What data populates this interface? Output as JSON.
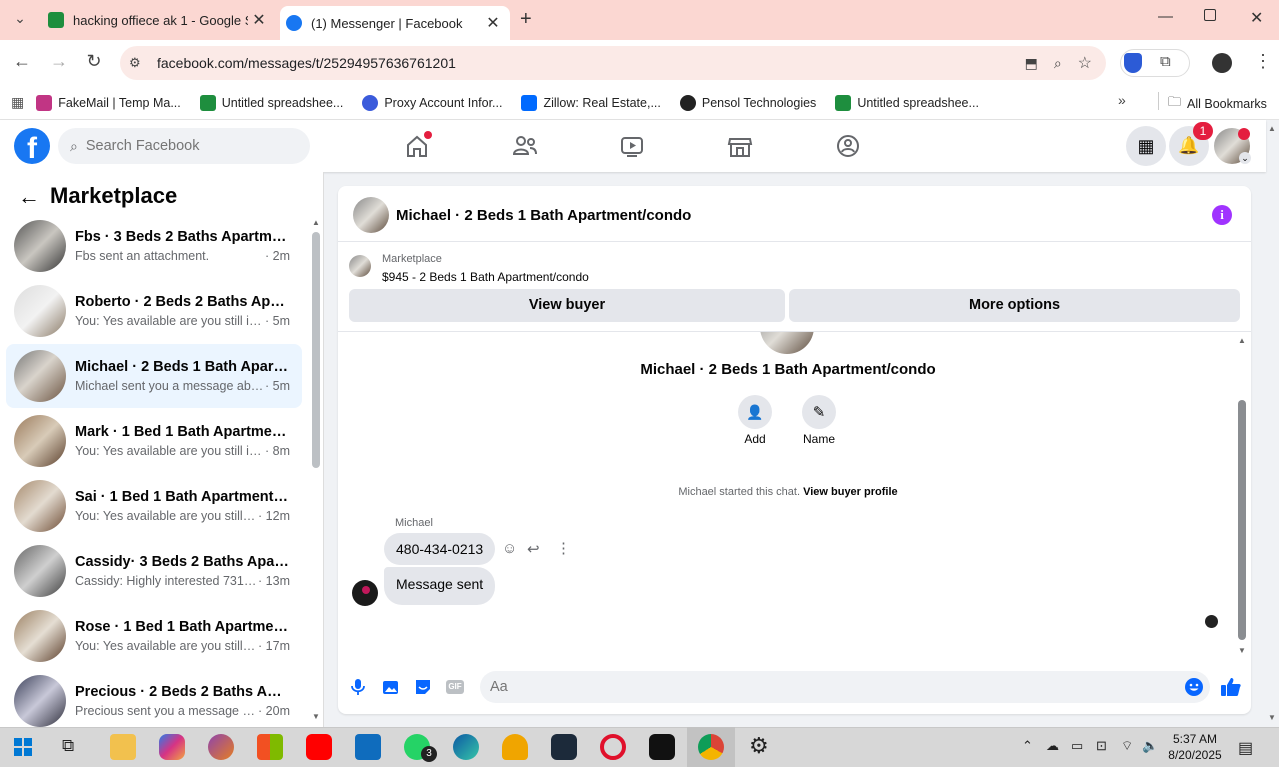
{
  "browser": {
    "tabs": [
      {
        "title": "hacking offiece ak 1 - Google Sh",
        "active": false
      },
      {
        "title": "(1) Messenger | Facebook",
        "active": true
      }
    ],
    "url": "facebook.com/messages/t/25294957636761201",
    "bookmarks": [
      "FakeMail | Temp Ma...",
      "Untitled spreadshee...",
      "Proxy Account Infor...",
      "Zillow: Real Estate,...",
      "Pensol Technologies",
      "Untitled spreadshee..."
    ],
    "all_bookmarks": "All Bookmarks"
  },
  "fb": {
    "search_placeholder": "Search Facebook",
    "notif_count": "1"
  },
  "sidebar": {
    "title": "Marketplace",
    "conversations": [
      {
        "name": "Fbs · 3 Beds 2 Baths Apartment/...",
        "preview": "Fbs sent an attachment.",
        "time": "· 2m"
      },
      {
        "name": "Roberto · 2 Beds 2 Baths Apart...",
        "preview": "You: Yes available are you still inter...",
        "time": "· 5m"
      },
      {
        "name": "Michael · 2 Beds 1 Bath Apartme...",
        "preview": "Michael sent you a message abou...",
        "time": "· 5m"
      },
      {
        "name": "Mark · 1 Bed 1 Bath Apartment/...",
        "preview": "You: Yes available are you still inter...",
        "time": "· 8m"
      },
      {
        "name": "Sai · 1 Bed 1 Bath Apartment/co...",
        "preview": "You: Yes available are you still int...",
        "time": "· 12m"
      },
      {
        "name": "Cassidy· 3 Beds 2 Baths Apartm...",
        "preview": "Cassidy: Highly interested 73129...",
        "time": "· 13m"
      },
      {
        "name": "Rose · 1 Bed 1 Bath Apartment/c...",
        "preview": "You: Yes available are you still int...",
        "time": "· 17m"
      },
      {
        "name": "Precious · 2 Beds 2 Baths Apart...",
        "preview": "Precious sent you a message abo...",
        "time": "· 20m"
      }
    ]
  },
  "chat": {
    "header_title": "Michael · 2 Beds 1 Bath Apartment/condo",
    "listing_label": "Marketplace",
    "listing_title": "$945 - 2 Beds 1 Bath Apartment/condo",
    "view_buyer": "View buyer",
    "more_options": "More options",
    "profile_title": "Michael · 2 Beds 1 Bath Apartment/condo",
    "add_label": "Add",
    "name_label": "Name",
    "started_text": "Michael started this chat.",
    "view_profile": "View buyer profile",
    "sender": "Michael",
    "messages": [
      "480-434-0213",
      "Message sent"
    ],
    "composer_placeholder": "Aa"
  },
  "taskbar": {
    "time": "5:37 AM",
    "date": "8/20/2025",
    "whatsapp_badge": "3"
  },
  "colors": {
    "fb_blue": "#1877f2",
    "messenger_blue": "#0866ff",
    "notif_red": "#e41e3f",
    "info_purple": "#a033ff",
    "chrome_tab_bg": "#fbd7d2"
  }
}
